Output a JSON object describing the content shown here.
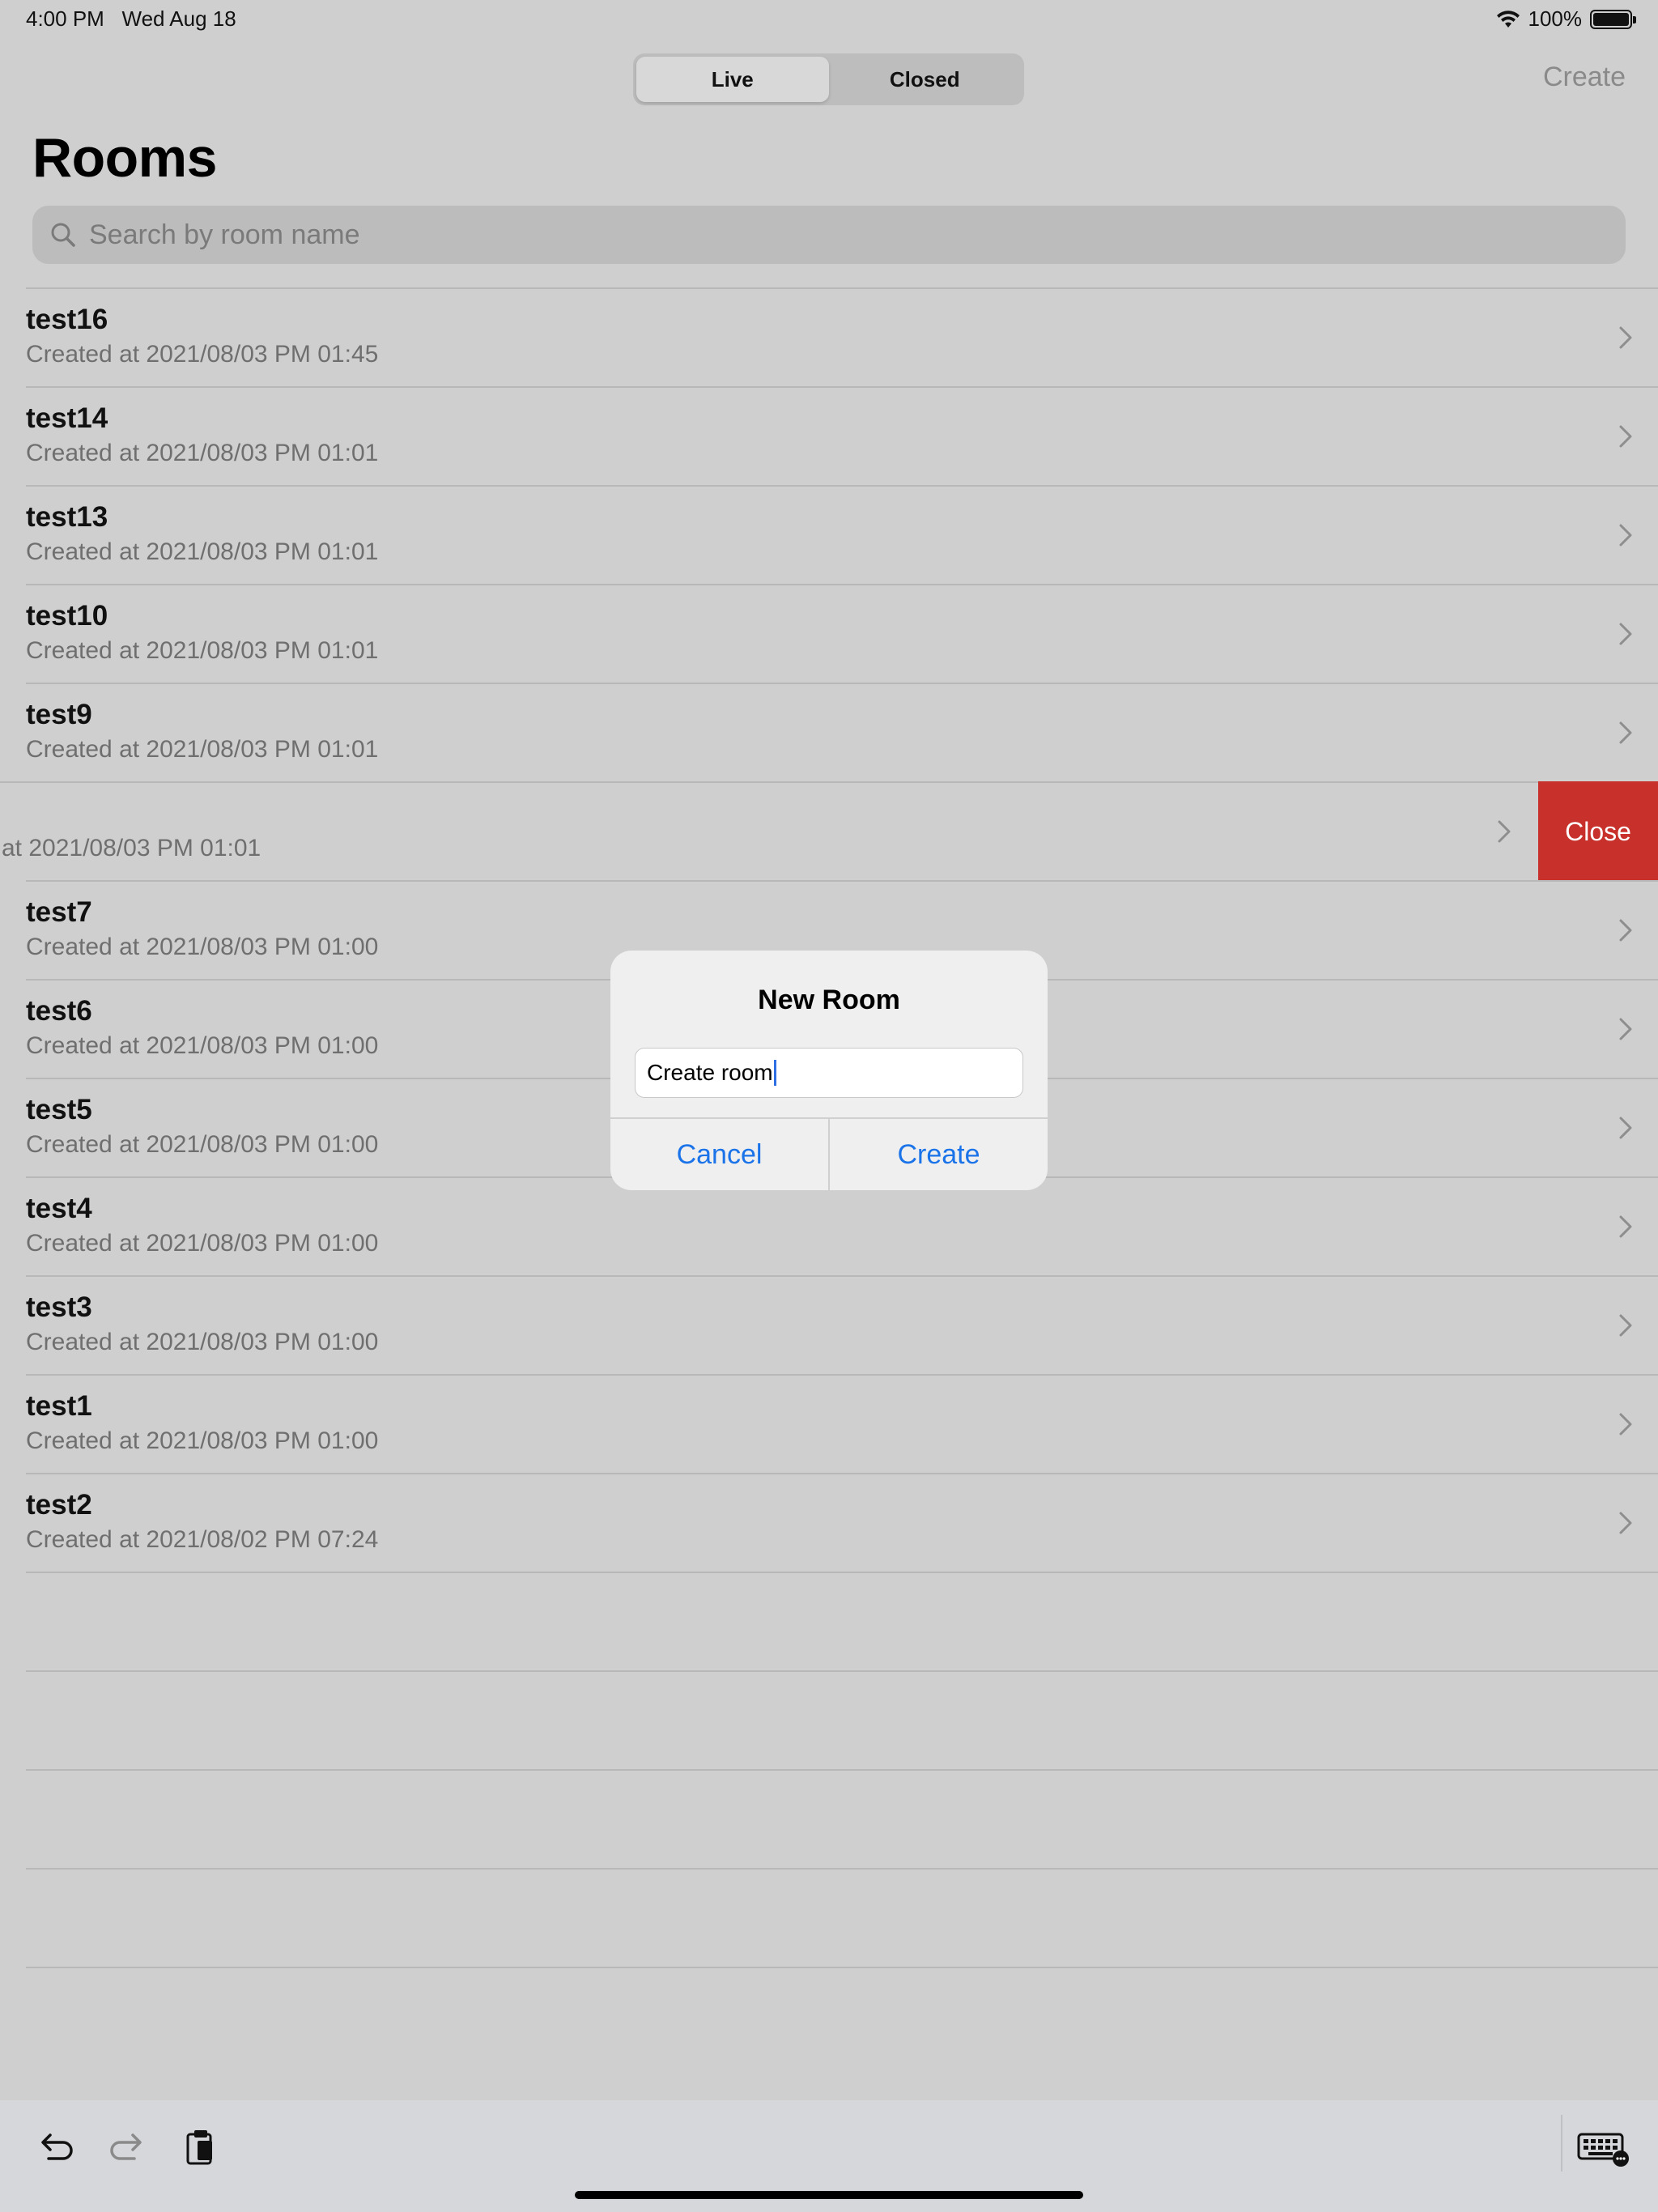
{
  "status_bar": {
    "time": "4:00 PM",
    "date": "Wed Aug 18",
    "battery": "100%",
    "battery_level": 1.0
  },
  "nav": {
    "segments": [
      {
        "label": "Live",
        "selected": true
      },
      {
        "label": "Closed",
        "selected": false
      }
    ],
    "create_label": "Create"
  },
  "page_title": "Rooms",
  "search": {
    "placeholder": "Search by room name",
    "icon": "search-icon"
  },
  "rooms": [
    {
      "name": "test16",
      "created": "Created at 2021/08/03 PM 01:45"
    },
    {
      "name": "test14",
      "created": "Created at 2021/08/03 PM 01:01"
    },
    {
      "name": "test13",
      "created": "Created at 2021/08/03 PM 01:01"
    },
    {
      "name": "test10",
      "created": "Created at 2021/08/03 PM 01:01"
    },
    {
      "name": "test9",
      "created": "Created at 2021/08/03 PM 01:01"
    },
    {
      "name": "",
      "created": "at 2021/08/03 PM 01:01",
      "swiped": true,
      "action_label": "Close"
    },
    {
      "name": "test7",
      "created": "Created at 2021/08/03 PM 01:00"
    },
    {
      "name": "test6",
      "created": "Created at 2021/08/03 PM 01:00"
    },
    {
      "name": "test5",
      "created": "Created at 2021/08/03 PM 01:00"
    },
    {
      "name": "test4",
      "created": "Created at 2021/08/03 PM 01:00"
    },
    {
      "name": "test3",
      "created": "Created at 2021/08/03 PM 01:00"
    },
    {
      "name": "test1",
      "created": "Created at 2021/08/03 PM 01:00"
    },
    {
      "name": "test2",
      "created": "Created at 2021/08/02 PM 07:24"
    }
  ],
  "dialog": {
    "title": "New Room",
    "input_value": "Create room",
    "cancel_label": "Cancel",
    "create_label": "Create"
  },
  "toolbar": {
    "icons": [
      "undo-icon",
      "redo-icon",
      "paste-icon",
      "keyboard-icon"
    ]
  },
  "colors": {
    "swipe_action": "#c8302b",
    "link": "#1a73e8",
    "background": "#cfcfcf"
  }
}
